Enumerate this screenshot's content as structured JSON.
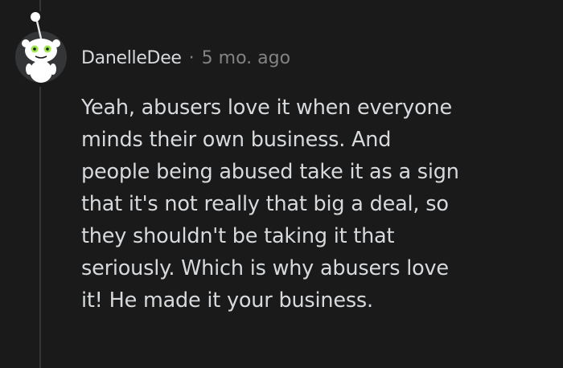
{
  "comment": {
    "author": "DanelleDee",
    "separator": "·",
    "timestamp": "5 mo. ago",
    "body_lines": [
      "Yeah, abusers love it when everyone",
      "minds their own business. And",
      "people being abused take it as a sign",
      "that it's not really that big a deal, so",
      "they shouldn't be taking it that",
      "seriously. Which is why abusers love",
      "it! He made it your business."
    ]
  },
  "colors": {
    "background": "#1a1a1b",
    "text_primary": "#d7dadc",
    "text_meta": "#818384",
    "thread_line": "#343536"
  },
  "icons": {
    "avatar": "snoo-avatar-icon"
  }
}
